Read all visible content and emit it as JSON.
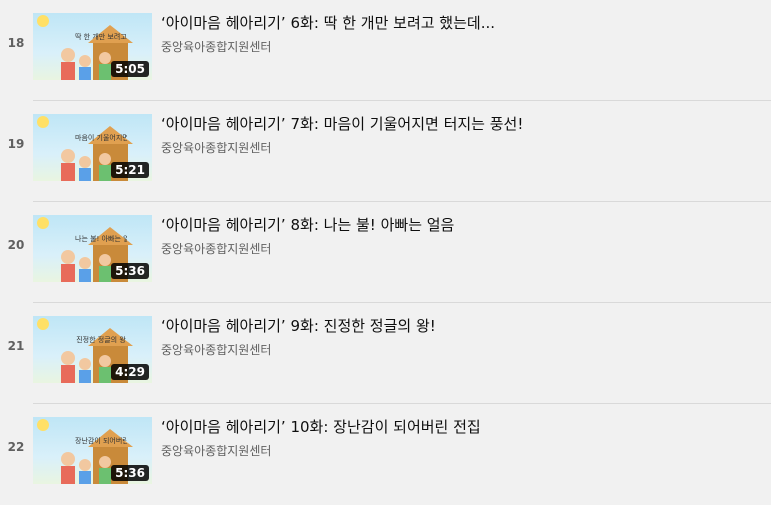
{
  "playlist": {
    "items": [
      {
        "index": "18",
        "title": "‘아이마음 헤아리기’ 6화: 딱 한 개만 보려고 했는데...",
        "channel": "중앙육아종합지원센터",
        "duration": "5:05",
        "caption": "딱 한 개만 보려고 했는데"
      },
      {
        "index": "19",
        "title": "‘아이마음 헤아리기’ 7화: 마음이 기울어지면 터지는 풍선!",
        "channel": "중앙육아종합지원센터",
        "duration": "5:21",
        "caption": "마음이 기울어지면 터지는 풍선"
      },
      {
        "index": "20",
        "title": "‘아이마음 헤아리기’ 8화: 나는 불! 아빠는 얼음",
        "channel": "중앙육아종합지원센터",
        "duration": "5:36",
        "caption": "나는 불! 아빠는 얼음"
      },
      {
        "index": "21",
        "title": "‘아이마음 헤아리기’ 9화: 진정한 정글의 왕!",
        "channel": "중앙육아종합지원센터",
        "duration": "4:29",
        "caption": "진정한 정글의 왕"
      },
      {
        "index": "22",
        "title": "‘아이마음 헤아리기’ 10화: 장난감이 되어버린 전집",
        "channel": "중앙육아종합지원센터",
        "duration": "5:36",
        "caption": "장난감이 되어버린 전집"
      }
    ]
  }
}
